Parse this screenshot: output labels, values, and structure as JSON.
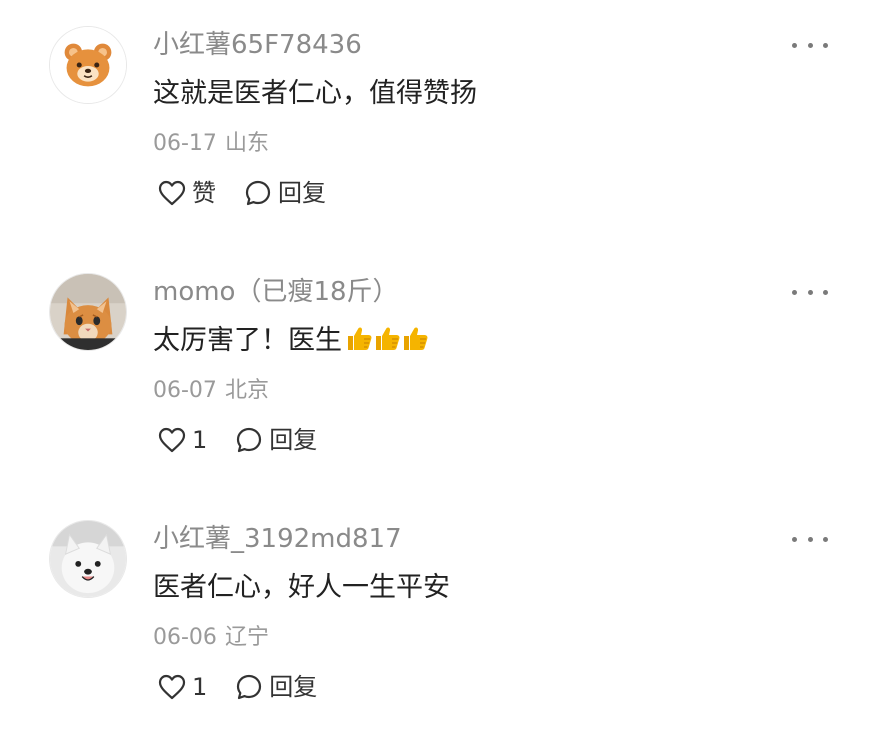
{
  "comments": [
    {
      "avatar_icon": "bear-avatar-icon",
      "username": "小红薯65F78436",
      "text": "这就是医者仁心，值得赞扬",
      "date": "06-17",
      "location": "山东",
      "like_label": "赞",
      "reply_label": "回复"
    },
    {
      "avatar_icon": "cat-avatar-icon",
      "username": "momo（已瘦18斤）",
      "text": "太厉害了！医生",
      "emoji_icon": "thumbs-up-icon",
      "emoji_count": 3,
      "date": "06-07",
      "location": "北京",
      "like_label": "1",
      "reply_label": "回复"
    },
    {
      "avatar_icon": "dog-avatar-icon",
      "username": "小红薯_3192md817",
      "text": "医者仁心，好人一生平安",
      "date": "06-06",
      "location": "辽宁",
      "like_label": "1",
      "reply_label": "回复"
    }
  ],
  "colors": {
    "username": "#8a8a8a",
    "meta": "#9a9a9a",
    "text": "#222222",
    "emoji": "#f5b400"
  }
}
